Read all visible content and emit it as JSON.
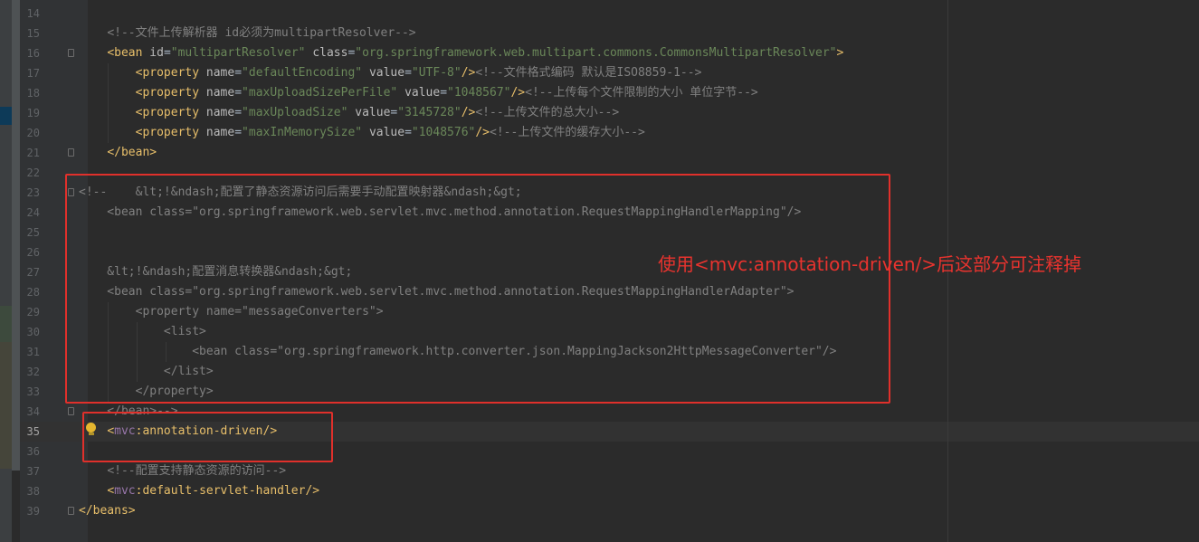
{
  "editor": {
    "current_line": 35,
    "lines": [
      {
        "num": "15",
        "text": "    <!--文件上传解析器 id必须为multipartResolver-->"
      },
      {
        "num": "16",
        "text": "    <bean id=\"multipartResolver\" class=\"org.springframework.web.multipart.commons.CommonsMultipartResolver\">"
      },
      {
        "num": "17",
        "text": "        <property name=\"defaultEncoding\" value=\"UTF-8\"/><!--文件格式编码 默认是ISO8859-1-->"
      },
      {
        "num": "18",
        "text": "        <property name=\"maxUploadSizePerFile\" value=\"1048567\"/><!--上传每个文件限制的大小 单位字节-->"
      },
      {
        "num": "19",
        "text": "        <property name=\"maxUploadSize\" value=\"3145728\"/><!--上传文件的总大小-->"
      },
      {
        "num": "20",
        "text": "        <property name=\"maxInMemorySize\" value=\"1048576\"/><!--上传文件的缓存大小-->"
      },
      {
        "num": "21",
        "text": "    </bean>"
      },
      {
        "num": "22",
        "text": ""
      },
      {
        "num": "23",
        "text": "<!--    &lt;!&ndash;配置了静态资源访问后需要手动配置映射器&ndash;&gt;"
      },
      {
        "num": "24",
        "text": "    <bean class=\"org.springframework.web.servlet.mvc.method.annotation.RequestMappingHandlerMapping\"/>"
      },
      {
        "num": "25",
        "text": ""
      },
      {
        "num": "26",
        "text": ""
      },
      {
        "num": "27",
        "text": "    &lt;!&ndash;配置消息转换器&ndash;&gt;"
      },
      {
        "num": "28",
        "text": "    <bean class=\"org.springframework.web.servlet.mvc.method.annotation.RequestMappingHandlerAdapter\">"
      },
      {
        "num": "29",
        "text": "        <property name=\"messageConverters\">"
      },
      {
        "num": "30",
        "text": "            <list>"
      },
      {
        "num": "31",
        "text": "                <bean class=\"org.springframework.http.converter.json.MappingJackson2HttpMessageConverter\"/>"
      },
      {
        "num": "32",
        "text": "            </list>"
      },
      {
        "num": "33",
        "text": "        </property>"
      },
      {
        "num": "34",
        "text": "    </bean>-->"
      },
      {
        "num": "35",
        "text": "    <mvc:annotation-driven/>"
      },
      {
        "num": "36",
        "text": ""
      },
      {
        "num": "37",
        "text": "    <!--配置支持静态资源的访问-->"
      },
      {
        "num": "38",
        "text": "    <mvc:default-servlet-handler/>"
      },
      {
        "num": "39",
        "text": "</beans>"
      }
    ],
    "first_line_num": "14"
  },
  "annotation": {
    "text": "使用<mvc:annotation-driven/>后这部分可注释掉",
    "color": "#e0302b"
  },
  "colors": {
    "background": "#2b2b2b",
    "tag": "#e8bf6a",
    "attribute": "#bababa",
    "value": "#6a8759",
    "comment": "#808080",
    "namespace": "#9876aa"
  }
}
